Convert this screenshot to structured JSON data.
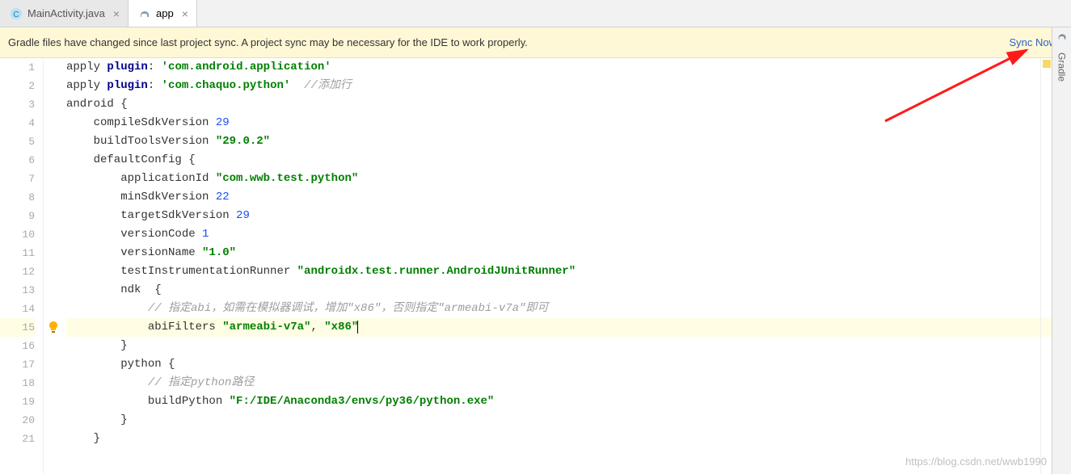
{
  "tabs": [
    {
      "label": "MainActivity.java",
      "icon": "c-icon",
      "active": false
    },
    {
      "label": "app",
      "icon": "elephant-icon",
      "active": true
    }
  ],
  "notice": {
    "message": "Gradle files have changed since last project sync. A project sync may be necessary for the IDE to work properly.",
    "action": "Sync Now"
  },
  "rightRail": {
    "gradle": "Gradle"
  },
  "watermark": "https://blog.csdn.net/wwb1990",
  "code": {
    "lines": [
      {
        "n": 1,
        "indent": 0,
        "segs": [
          [
            "apply ",
            ""
          ],
          [
            "plugin",
            "kw"
          ],
          [
            ": ",
            ""
          ],
          [
            "'com.android.application'",
            "str"
          ]
        ]
      },
      {
        "n": 2,
        "indent": 0,
        "segs": [
          [
            "apply ",
            ""
          ],
          [
            "plugin",
            "kw"
          ],
          [
            ": ",
            ""
          ],
          [
            "'com.chaquo.python'",
            "str"
          ],
          [
            "  ",
            ""
          ],
          [
            "//添加行",
            "cmt"
          ]
        ]
      },
      {
        "n": 3,
        "indent": 0,
        "segs": [
          [
            "android {",
            ""
          ]
        ]
      },
      {
        "n": 4,
        "indent": 1,
        "segs": [
          [
            "compileSdkVersion ",
            ""
          ],
          [
            "29",
            "num"
          ]
        ]
      },
      {
        "n": 5,
        "indent": 1,
        "segs": [
          [
            "buildToolsVersion ",
            ""
          ],
          [
            "\"29.0.2\"",
            "str"
          ]
        ]
      },
      {
        "n": 6,
        "indent": 1,
        "segs": [
          [
            "defaultConfig {",
            ""
          ]
        ]
      },
      {
        "n": 7,
        "indent": 2,
        "segs": [
          [
            "applicationId ",
            ""
          ],
          [
            "\"com.wwb.test.python\"",
            "str"
          ]
        ]
      },
      {
        "n": 8,
        "indent": 2,
        "segs": [
          [
            "minSdkVersion ",
            ""
          ],
          [
            "22",
            "num"
          ]
        ]
      },
      {
        "n": 9,
        "indent": 2,
        "segs": [
          [
            "targetSdkVersion ",
            ""
          ],
          [
            "29",
            "num"
          ]
        ]
      },
      {
        "n": 10,
        "indent": 2,
        "segs": [
          [
            "versionCode ",
            ""
          ],
          [
            "1",
            "num"
          ]
        ]
      },
      {
        "n": 11,
        "indent": 2,
        "segs": [
          [
            "versionName ",
            ""
          ],
          [
            "\"1.0\"",
            "str"
          ]
        ]
      },
      {
        "n": 12,
        "indent": 2,
        "segs": [
          [
            "testInstrumentationRunner ",
            ""
          ],
          [
            "\"androidx.test.runner.AndroidJUnitRunner\"",
            "str"
          ]
        ]
      },
      {
        "n": 13,
        "indent": 2,
        "segs": [
          [
            "ndk  {",
            ""
          ]
        ]
      },
      {
        "n": 14,
        "indent": 3,
        "segs": [
          [
            "// 指定abi，如需在模拟器调试，增加\"x86\"，否则指定\"armeabi-v7a\"即可",
            "cmt"
          ]
        ]
      },
      {
        "n": 15,
        "indent": 3,
        "hl": true,
        "bulb": true,
        "caret": true,
        "segs": [
          [
            "abiFilters ",
            ""
          ],
          [
            "\"armeabi-v7a\"",
            "str"
          ],
          [
            ", ",
            ""
          ],
          [
            "\"x86\"",
            "str"
          ]
        ]
      },
      {
        "n": 16,
        "indent": 2,
        "segs": [
          [
            "}",
            ""
          ]
        ]
      },
      {
        "n": 17,
        "indent": 2,
        "segs": [
          [
            "python {",
            ""
          ]
        ]
      },
      {
        "n": 18,
        "indent": 3,
        "segs": [
          [
            "// 指定python路径",
            "cmt"
          ]
        ]
      },
      {
        "n": 19,
        "indent": 3,
        "segs": [
          [
            "buildPython ",
            ""
          ],
          [
            "\"F:/IDE/Anaconda3/envs/py36/python.exe\"",
            "str"
          ]
        ]
      },
      {
        "n": 20,
        "indent": 2,
        "segs": [
          [
            "}",
            ""
          ]
        ]
      },
      {
        "n": 21,
        "indent": 1,
        "segs": [
          [
            "}",
            ""
          ]
        ]
      }
    ]
  }
}
